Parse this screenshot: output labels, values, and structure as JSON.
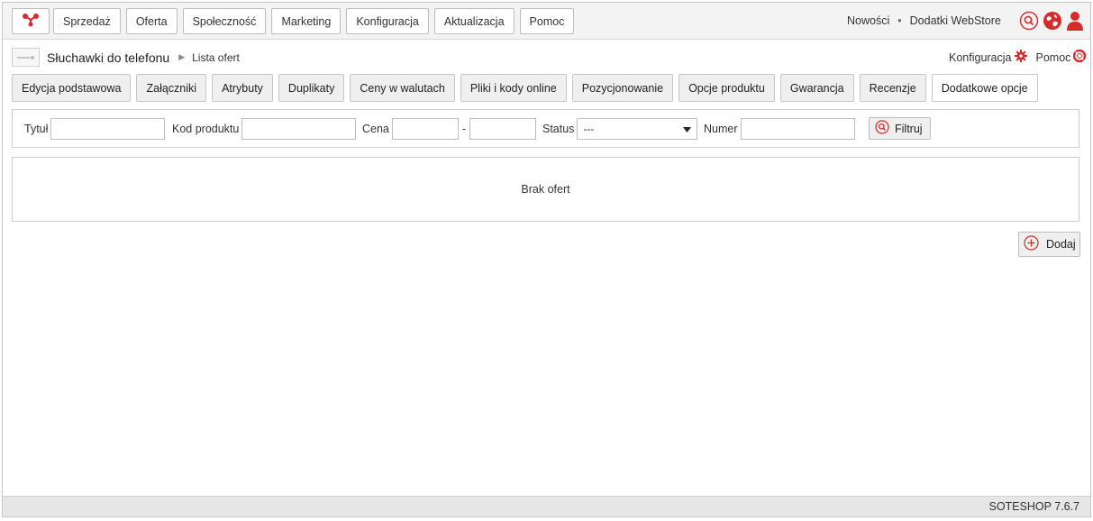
{
  "topbar": {
    "menu": [
      "Sprzedaż",
      "Oferta",
      "Społeczność",
      "Marketing",
      "Konfiguracja",
      "Aktualizacja",
      "Pomoc"
    ],
    "links": [
      "Nowości",
      "Dodatki WebStore"
    ],
    "link_separator": "•"
  },
  "breadcrumb": {
    "product": "Słuchawki do telefonu",
    "separator": "▶",
    "current": "Lista ofert",
    "right": {
      "config": "Konfiguracja",
      "help": "Pomoc"
    }
  },
  "tabs": [
    "Edycja podstawowa",
    "Załączniki",
    "Atrybuty",
    "Duplikaty",
    "Ceny w walutach",
    "Pliki i kody online",
    "Pozycjonowanie",
    "Opcje produktu",
    "Gwarancja",
    "Recenzje",
    "Dodatkowe opcje"
  ],
  "active_tab_index": 10,
  "filter": {
    "title_label": "Tytuł",
    "code_label": "Kod produktu",
    "price_label": "Cena",
    "price_dash": "-",
    "status_label": "Status",
    "status_value": "---",
    "number_label": "Numer",
    "button": "Filtruj"
  },
  "results": {
    "empty": "Brak ofert"
  },
  "add_button": "Dodaj",
  "footer": {
    "version": "SOTESHOP 7.6.7"
  },
  "colors": {
    "accent": "#d62b2b",
    "tab_bg": "#efefef",
    "topbar_bg": "#f3f3f3"
  }
}
